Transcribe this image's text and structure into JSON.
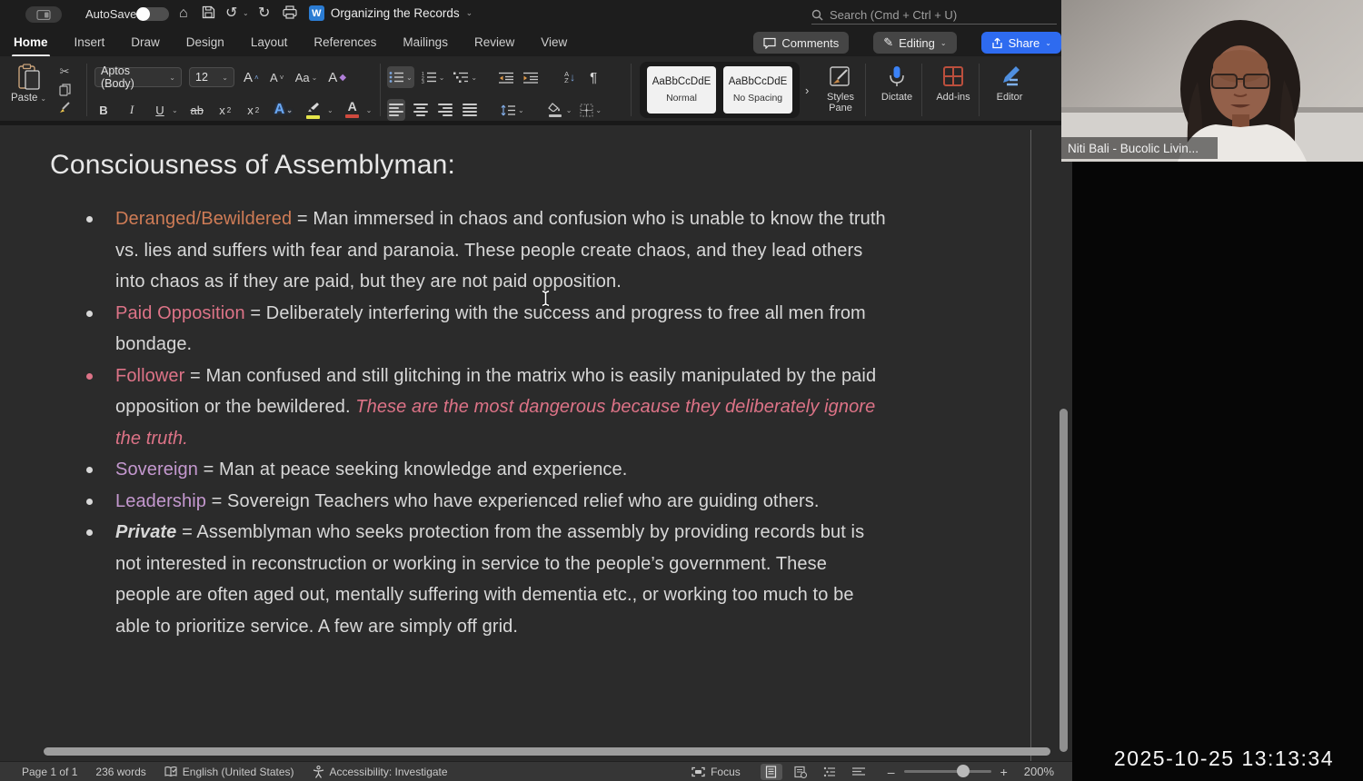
{
  "titlebar": {
    "autosave_label": "AutoSave",
    "doc_title": "Organizing the Records",
    "search_placeholder": "Search (Cmd + Ctrl + U)",
    "more_glyph": "⋯"
  },
  "tabs": {
    "items": [
      "Home",
      "Insert",
      "Draw",
      "Design",
      "Layout",
      "References",
      "Mailings",
      "Review",
      "View"
    ],
    "active": "Home"
  },
  "actions": {
    "comments": "Comments",
    "editing": "Editing",
    "share": "Share"
  },
  "ribbon": {
    "paste_label": "Paste",
    "font_name": "Aptos (Body)",
    "font_size": "12",
    "bold": "B",
    "italic": "I",
    "underline": "U",
    "strikethrough": "ab",
    "subscript_base": "x",
    "superscript_base": "x",
    "text_effects": "A",
    "change_case": "Aa",
    "clear_format": "A",
    "grow_font": "A",
    "shrink_font": "A",
    "font_color": "A",
    "pilcrow": "¶",
    "sort_a": "A",
    "sort_z": "Z",
    "style_cards": [
      {
        "sample": "AaBbCcDdE",
        "name": "Normal"
      },
      {
        "sample": "AaBbCcDdE",
        "name": "No Spacing"
      }
    ],
    "styles_pane": "Styles Pane",
    "dictate": "Dictate",
    "addins": "Add-ins",
    "editor": "Editor"
  },
  "document": {
    "heading": "Consciousness of Assemblyman:",
    "colors": {
      "orange": "#cf7c56",
      "pink": "#dd7387",
      "purple": "#c498cf",
      "body": "#d8d8d8"
    },
    "bullets": [
      {
        "segments": [
          {
            "text": "Deranged/Bewildered",
            "color": "orange"
          },
          {
            "text": " = Man immersed in chaos and confusion who is unable to know the truth vs. lies and suffers with fear and paranoia. These people create chaos, and they lead others into chaos as if they are paid, but they are not paid opposition."
          }
        ]
      },
      {
        "segments": [
          {
            "text": "Paid Opposition",
            "color": "pink"
          },
          {
            "text": " = Deliberately interfering with the success and progress to free all men from bondage."
          }
        ]
      },
      {
        "bullet_color": "pink",
        "segments": [
          {
            "text": "Follower",
            "color": "pink"
          },
          {
            "text": " = Man confused and still glitching in the matrix who is easily manipulated by the paid opposition or the bewildered. "
          },
          {
            "text": "These are the most dangerous because they deliberately ignore the truth.",
            "color": "pink",
            "italic": true
          }
        ]
      },
      {
        "segments": [
          {
            "text": "Sovereign",
            "color": "purple"
          },
          {
            "text": " = Man at peace seeking knowledge and experience."
          }
        ]
      },
      {
        "segments": [
          {
            "text": "Leadership",
            "color": "purple"
          },
          {
            "text": " = Sovereign Teachers who have experienced relief who are guiding others."
          }
        ]
      },
      {
        "segments": [
          {
            "text": "Private",
            "bold": true,
            "italic": true
          },
          {
            "text": " = Assemblyman who seeks protection from the assembly by providing records but is not interested in reconstruction or working in service to the people’s government. These people are often aged out, mentally suffering with dementia etc., or working too much to be able to prioritize service. A few are simply off grid."
          }
        ]
      }
    ]
  },
  "statusbar": {
    "page": "Page 1 of 1",
    "words": "236 words",
    "language": "English (United States)",
    "accessibility": "Accessibility: Investigate",
    "focus": "Focus",
    "zoom_level": "200%",
    "zoom_minus": "–",
    "zoom_plus": "+"
  },
  "overlay": {
    "participant_name": "Niti Bali - Bucolic Livin...",
    "timestamp": "2025-10-25 13:13:34"
  }
}
